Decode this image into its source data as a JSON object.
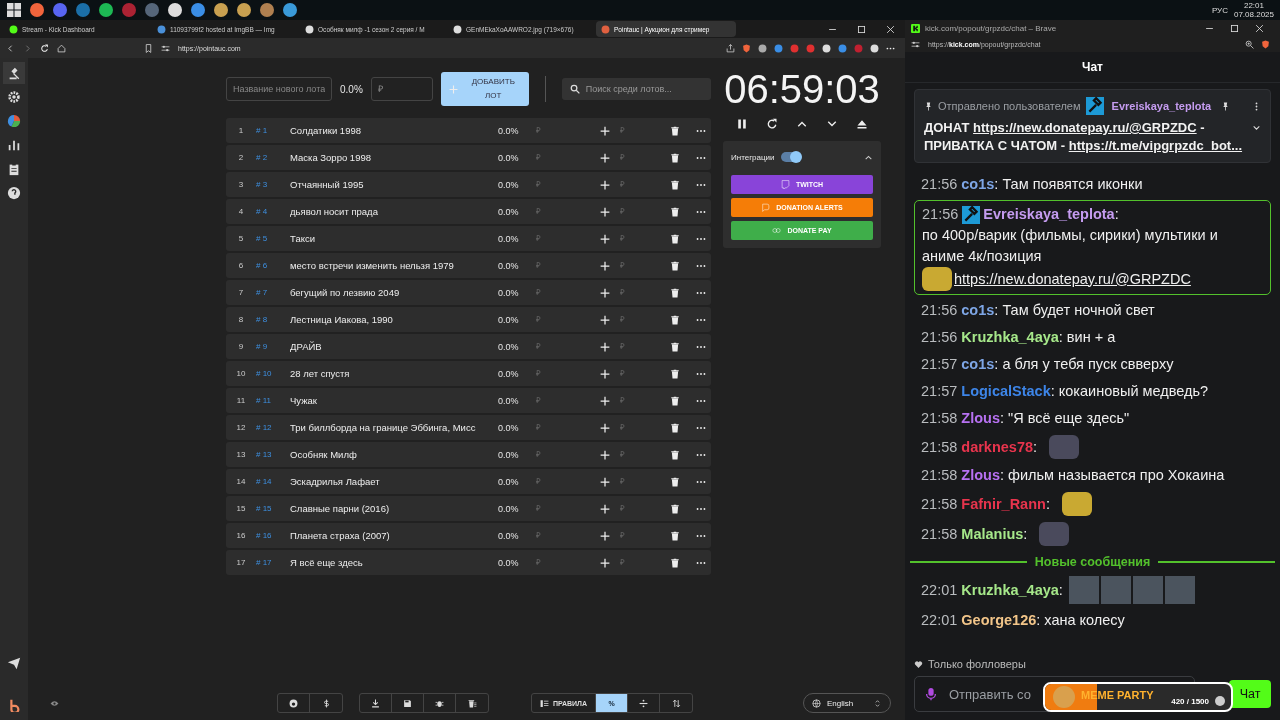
{
  "taskbar": {
    "language": "РУС",
    "time": "22:01",
    "date": "07.08.2025"
  },
  "browser": {
    "tabs": [
      {
        "title": "Stream - Kick Dashboard",
        "selected": false
      },
      {
        "title": "11093799f2 hosted at ImgBB — Img",
        "selected": false
      },
      {
        "title": "Особняк милф -1 сезон 2 серия / М",
        "selected": false
      },
      {
        "title": "GEnMEkaXoAAWRO2.jpg (719×676)",
        "selected": false
      },
      {
        "title": "Pointauc | Аукцион для стример",
        "selected": true
      }
    ],
    "url": "https://pointauc.com"
  },
  "new_lot": {
    "name_placeholder": "Название нового лота",
    "percent": "0.0%",
    "amount_placeholder": "₽",
    "add_button": "ДОБАВИТЬ ЛОТ"
  },
  "search": {
    "placeholder": "Поиск среди лотов..."
  },
  "lots": [
    {
      "index": "1",
      "tag": "# 1",
      "name": "Солдатики 1998",
      "percent": "0.0%",
      "amount_placeholder": "₽",
      "add_placeholder": "₽"
    },
    {
      "index": "2",
      "tag": "# 2",
      "name": "Маска Зорро 1998",
      "percent": "0.0%",
      "amount_placeholder": "₽",
      "add_placeholder": "₽"
    },
    {
      "index": "3",
      "tag": "# 3",
      "name": "Отчаянный 1995",
      "percent": "0.0%",
      "amount_placeholder": "₽",
      "add_placeholder": "₽"
    },
    {
      "index": "4",
      "tag": "# 4",
      "name": "дьявол носит прада",
      "percent": "0.0%",
      "amount_placeholder": "₽",
      "add_placeholder": "₽"
    },
    {
      "index": "5",
      "tag": "# 5",
      "name": "Такси",
      "percent": "0.0%",
      "amount_placeholder": "₽",
      "add_placeholder": "₽"
    },
    {
      "index": "6",
      "tag": "# 6",
      "name": "место встречи изменить нельзя 1979",
      "percent": "0.0%",
      "amount_placeholder": "₽",
      "add_placeholder": "₽"
    },
    {
      "index": "7",
      "tag": "# 7",
      "name": "бегущий по лезвию 2049",
      "percent": "0.0%",
      "amount_placeholder": "₽",
      "add_placeholder": "₽"
    },
    {
      "index": "8",
      "tag": "# 8",
      "name": "Лестница Иакова, 1990",
      "percent": "0.0%",
      "amount_placeholder": "₽",
      "add_placeholder": "₽"
    },
    {
      "index": "9",
      "tag": "# 9",
      "name": "ДРАЙВ",
      "percent": "0.0%",
      "amount_placeholder": "₽",
      "add_placeholder": "₽"
    },
    {
      "index": "10",
      "tag": "# 10",
      "name": "28 лет спустя",
      "percent": "0.0%",
      "amount_placeholder": "₽",
      "add_placeholder": "₽"
    },
    {
      "index": "11",
      "tag": "# 11",
      "name": "Чужак",
      "percent": "0.0%",
      "amount_placeholder": "₽",
      "add_placeholder": "₽"
    },
    {
      "index": "12",
      "tag": "# 12",
      "name": "Три биллборда на границе Эббинга, Мисс",
      "percent": "0.0%",
      "amount_placeholder": "₽",
      "add_placeholder": "₽"
    },
    {
      "index": "13",
      "tag": "# 13",
      "name": "Особняк Милф",
      "percent": "0.0%",
      "amount_placeholder": "₽",
      "add_placeholder": "₽"
    },
    {
      "index": "14",
      "tag": "# 14",
      "name": "Эскадрилья Лафает",
      "percent": "0.0%",
      "amount_placeholder": "₽",
      "add_placeholder": "₽"
    },
    {
      "index": "15",
      "tag": "# 15",
      "name": "Славные парни (2016)",
      "percent": "0.0%",
      "amount_placeholder": "₽",
      "add_placeholder": "₽"
    },
    {
      "index": "16",
      "tag": "# 16",
      "name": "Планета страха (2007)",
      "percent": "0.0%",
      "amount_placeholder": "₽",
      "add_placeholder": "₽"
    },
    {
      "index": "17",
      "tag": "# 17",
      "name": "Я всё еще здесь",
      "percent": "0.0%",
      "amount_placeholder": "₽",
      "add_placeholder": "₽"
    }
  ],
  "timer": {
    "time": "06:59:03"
  },
  "integrations": {
    "label": "Интеграции",
    "on": true,
    "expanded": true,
    "services": [
      {
        "kind": "twitch",
        "label": "TWITCH"
      },
      {
        "kind": "donationalerts",
        "label": "DONATION ALERTS"
      },
      {
        "kind": "donatepay",
        "label": "DONATE PAY"
      }
    ]
  },
  "bottom_toolbar": {
    "rules_button": "ПРАВИЛА",
    "modes": [
      {
        "kind": "percent",
        "label": "%",
        "selected": true
      },
      {
        "kind": "divide",
        "selected": false
      },
      {
        "kind": "sort",
        "selected": false
      }
    ],
    "language": "English"
  },
  "chat_window": {
    "title": "kick.com/popout/grpzdc/chat – Brave",
    "url": "https://**kick.com**/popout/grpzdc/chat"
  },
  "chat": {
    "header": "Чат",
    "pinned": {
      "label": "Отправлено пользователем",
      "user": "Evreiskaya_teplota",
      "color": "#c59cf0",
      "parts": [
        {
          "kind": "text",
          "text": "ДОНАТ "
        },
        {
          "kind": "link",
          "text": "https://new.donatepay.ru/@GRPZDC"
        },
        {
          "kind": "text",
          "text": " - ПРИВАТКА С ЧАТОМ - "
        },
        {
          "kind": "link",
          "text": "https://t.me/vipgrpzdc_bot..."
        }
      ]
    },
    "messages": [
      {
        "kind": "text",
        "time": "21:56",
        "user": "co1s",
        "color": "#7ea6e6",
        "separator": ":",
        "text": "Там появятся иконки"
      },
      {
        "kind": "highlight",
        "time": "21:56",
        "user": "Evreiskaya_teplota",
        "color": "#c59cf0",
        "separator": ":",
        "text": "по 400р/варик (фильмы, сирики) мультики и аниме 4к/позиция",
        "link": "https://new.donatepay.ru/@GRPZDC"
      },
      {
        "kind": "text",
        "time": "21:56",
        "user": "co1s",
        "color": "#7ea6e6",
        "separator": ":",
        "text": "Там будет ночной свет"
      },
      {
        "kind": "text",
        "time": "21:56",
        "user": "Kruzhka_4aya",
        "color": "#a6e88a",
        "separator": ":",
        "text": "вин + а"
      },
      {
        "kind": "text",
        "time": "21:57",
        "user": "co1s",
        "color": "#7ea6e6",
        "separator": ":",
        "text": "а бля у тебя пуск свверху"
      },
      {
        "kind": "text",
        "time": "21:57",
        "user": "LogicalStack",
        "color": "#3d85e8",
        "separator": ":",
        "text": "кокаиновый медведь?"
      },
      {
        "kind": "text",
        "time": "21:58",
        "user": "Zlous",
        "color": "#b771f2",
        "separator": ":",
        "text": "\"Я всё еще здесь\""
      },
      {
        "kind": "emote",
        "time": "21:58",
        "user": "darknes78",
        "color": "#e8344d",
        "separator": ":"
      },
      {
        "kind": "text",
        "time": "21:58",
        "user": "Zlous",
        "color": "#b771f2",
        "separator": ":",
        "text": "фильм называется про Хокаина"
      },
      {
        "kind": "emote",
        "time": "21:58",
        "user": "Fafnir_Rann",
        "color": "#e8344d",
        "separator": ":"
      },
      {
        "kind": "emote",
        "time": "21:58",
        "user": "Malanius",
        "color": "#a6e88a",
        "separator": ":"
      },
      {
        "kind": "divider",
        "text": "Новые сообщения"
      },
      {
        "kind": "emote_row",
        "time": "22:01",
        "user": "Kruzhka_4aya",
        "color": "#a6e88a",
        "separator": ":"
      },
      {
        "kind": "text",
        "time": "22:01",
        "user": "George126",
        "color": "#f2c589",
        "separator": ":",
        "text": "хана колесу"
      }
    ],
    "followers_only": "Только фолловеры",
    "input": {
      "placeholder": "Отправить со"
    },
    "send_button": "Чат",
    "meme_party": {
      "title": "MEME PARTY",
      "count": "420 / 1500",
      "level": 0.28
    }
  }
}
